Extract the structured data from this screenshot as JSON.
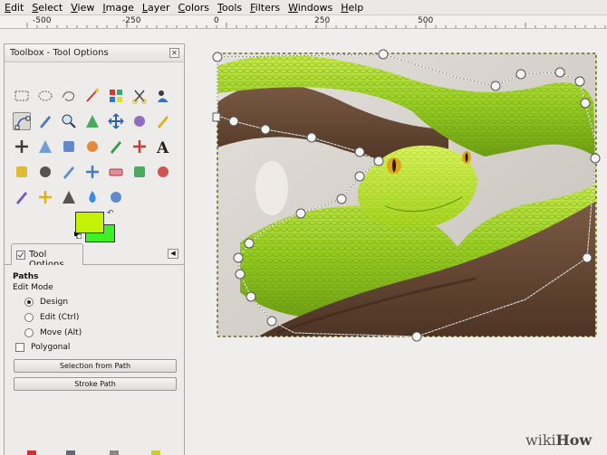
{
  "menu": [
    "Edit",
    "Select",
    "View",
    "Image",
    "Layer",
    "Colors",
    "Tools",
    "Filters",
    "Windows",
    "Help"
  ],
  "ruler": {
    "labels": [
      "-500",
      "-250",
      "0",
      "250",
      "500"
    ]
  },
  "toolbox": {
    "title": "Toolbox - Tool Options",
    "close_icon": "close-icon",
    "tools": [
      "rect-select-icon",
      "ellipse-select-icon",
      "free-select-icon",
      "fuzzy-select-icon",
      "select-by-color-icon",
      "scissors-icon",
      "foreground-select-icon",
      "paths-icon",
      "color-picker-icon",
      "zoom-icon",
      "measure-icon",
      "move-icon",
      "align-icon",
      "crop-icon",
      "rotate-icon",
      "scale-icon",
      "shear-icon",
      "perspective-icon",
      "flip-icon",
      "cage-transform-icon",
      "text-icon",
      "bucket-fill-icon",
      "blend-icon",
      "pencil-icon",
      "paintbrush-icon",
      "eraser-icon",
      "airbrush-icon",
      "ink-icon",
      "clone-icon",
      "heal-icon",
      "smudge-icon",
      "blur-icon",
      "dodge-burn-icon"
    ],
    "active_tool": "paths-icon",
    "colors": {
      "foreground": "#c4f207",
      "background": "#3fef2a"
    }
  },
  "tool_options": {
    "tab_label": "Tool Options",
    "heading": "Paths",
    "edit_mode_label": "Edit Mode",
    "modes": [
      {
        "label": "Design",
        "checked": true
      },
      {
        "label": "Edit (Ctrl)",
        "checked": false
      },
      {
        "label": "Move (Alt)",
        "checked": false
      }
    ],
    "polygonal": {
      "label": "Polygonal",
      "checked": false
    },
    "selection_button": "Selection from Path",
    "stroke_button": "Stroke Path"
  },
  "watermark": {
    "wiki": "wiki",
    "how": "How"
  }
}
